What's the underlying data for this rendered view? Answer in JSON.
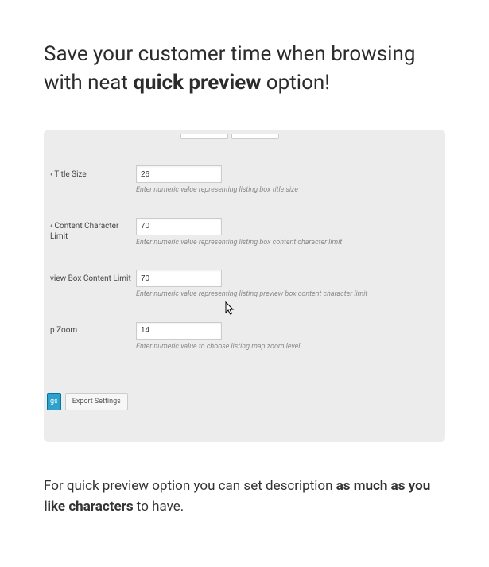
{
  "headline": {
    "part1": "Save your customer time when browsing with neat ",
    "bold": "quick preview",
    "part2": " option!"
  },
  "fields": {
    "titleSize": {
      "label": "‹ Title Size",
      "value": "26",
      "hint": "Enter numeric value representing listing box title size"
    },
    "contentCharLimit": {
      "label": "‹ Content Character Limit",
      "value": "70",
      "hint": "Enter numeric value representing listing box content character limit"
    },
    "viewBoxContent": {
      "label": "view Box Content Limit",
      "value": "70",
      "hint": "Enter numeric value representing listing preview box content character limit"
    },
    "pZoom": {
      "label": "p Zoom",
      "value": "14",
      "hint": "Enter numeric value to choose listing map zoom level"
    }
  },
  "buttons": {
    "gs": "gs",
    "export": "Export Settings"
  },
  "footer": {
    "part1": "For quick preview option you can set description ",
    "bold": "as much as you like characters",
    "part2": " to have."
  }
}
